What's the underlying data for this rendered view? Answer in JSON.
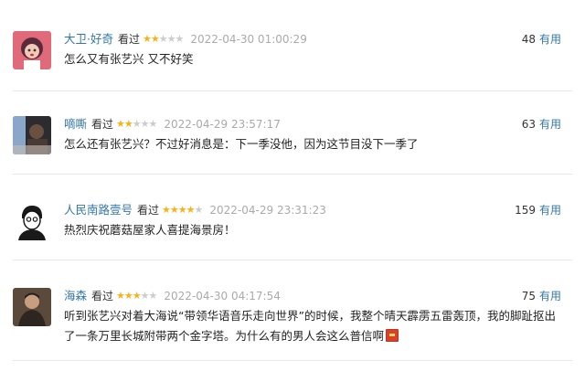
{
  "comments": [
    {
      "user": "大卫·好奇",
      "action": "看过",
      "rating": 2,
      "time": "2022-04-30 01:00:29",
      "votes": "48",
      "useful": "有用",
      "text": "怎么又有张艺兴 又不好笑",
      "avatar": "avatar-woman-illustration"
    },
    {
      "user": "嘀嘶",
      "action": "看过",
      "rating": 2,
      "time": "2022-04-29 23:57:17",
      "votes": "63",
      "useful": "有用",
      "text": "怎么还有张艺兴？不过好消息是：下一季没他，因为这节目没下一季了",
      "avatar": "avatar-photo"
    },
    {
      "user": "人民南路壹号",
      "action": "看过",
      "rating": 4,
      "time": "2022-04-29 23:31:23",
      "votes": "159",
      "useful": "有用",
      "text": "热烈庆祝蘑菇屋家人喜提海景房！",
      "avatar": "avatar-sketch-man"
    },
    {
      "user": "海森",
      "action": "看过",
      "rating": 3,
      "time": "2022-04-30 04:17:54",
      "votes": "75",
      "useful": "有用",
      "text": "听到张艺兴对着大海说“带领华语音乐走向世界”的时候，我整个晴天霹雳五雷轰顶，我的脚趾抠出了一条万里长城附带两个金字塔。为什么有的男人会这么普信啊",
      "avatar": "avatar-man-photo"
    }
  ],
  "star_glyph": "★",
  "colors": {
    "link": "#3377aa",
    "star": "#f6b21b",
    "star_off": "#cccccc",
    "time": "#aaaaaa"
  }
}
